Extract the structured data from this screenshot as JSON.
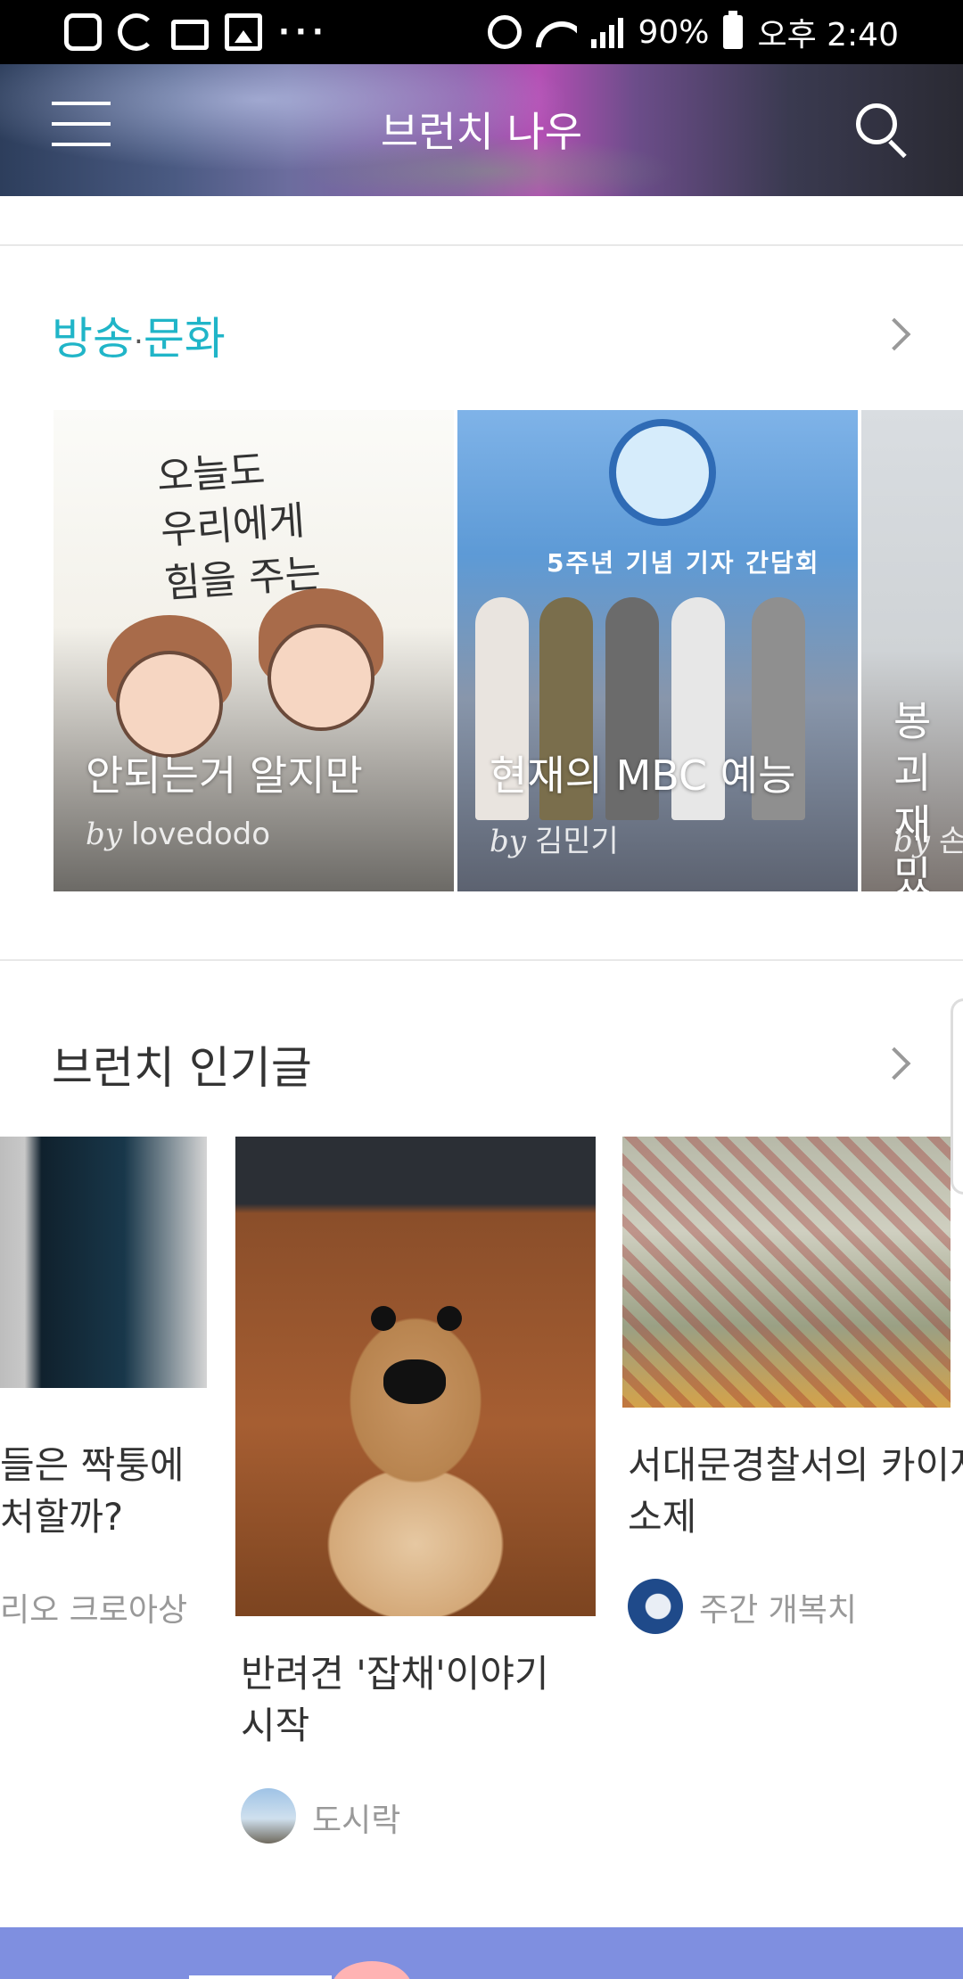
{
  "status_bar": {
    "battery": "90%",
    "time": "오후 2:40",
    "more": "···"
  },
  "header": {
    "title": "브런치 나우"
  },
  "culture_section": {
    "title_part1": "방송",
    "title_sep": "·",
    "title_part2": "문화",
    "accent_color": "#20b5c8",
    "illustration_text": "오늘도\n우리에게\n힘을 주는",
    "card2_banner": "5주년 기념 기자 간담회",
    "cards": [
      {
        "title": "안되는거 알지만",
        "by": "by",
        "author": "lovedodo"
      },
      {
        "title": "현재의 MBC 예능",
        "by": "by",
        "author": "김민기"
      },
      {
        "title": "봉괴 재밌",
        "by": "by",
        "author": "손"
      }
    ]
  },
  "popular_section": {
    "title": "브런치 인기글",
    "cards": [
      {
        "title_line1": "들은 짝퉁에",
        "title_line2": "처할까?",
        "author": "리오 크로아상"
      },
      {
        "title_line1": "반려견 '잡채'이야기",
        "title_line2": "시작",
        "author": "도시락"
      },
      {
        "title_line1": "서대문경찰서의 카이저",
        "title_line2": "소제",
        "author": "주간 개복치"
      }
    ]
  }
}
